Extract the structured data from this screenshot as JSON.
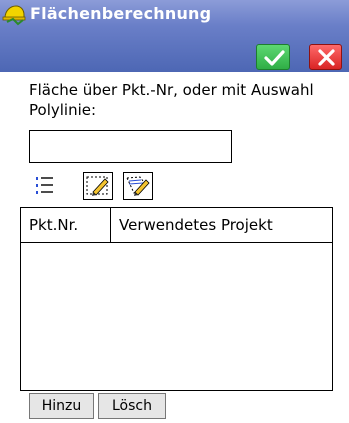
{
  "window": {
    "title": "Flächenberechnung",
    "app_icon": "helmet-icon",
    "ok_icon": "checkmark-icon",
    "cancel_icon": "close-icon",
    "titlebar_color": "#5b6fbe",
    "ok_color": "#3cc456",
    "cancel_color": "#e23333"
  },
  "form": {
    "instruction": "Fläche über Pkt.-Nr, oder mit Auswahl Polylinie:",
    "point_input_value": "",
    "tools": [
      {
        "name": "list",
        "icon": "numbered-list-icon"
      },
      {
        "name": "edit",
        "icon": "edit-area-icon"
      },
      {
        "name": "select",
        "icon": "select-polyline-icon"
      }
    ]
  },
  "table": {
    "columns": [
      "Pkt.Nr.",
      "Verwendetes Projekt"
    ],
    "rows": []
  },
  "buttons": {
    "add_label": "Hinzu",
    "delete_label": "Lösch"
  }
}
